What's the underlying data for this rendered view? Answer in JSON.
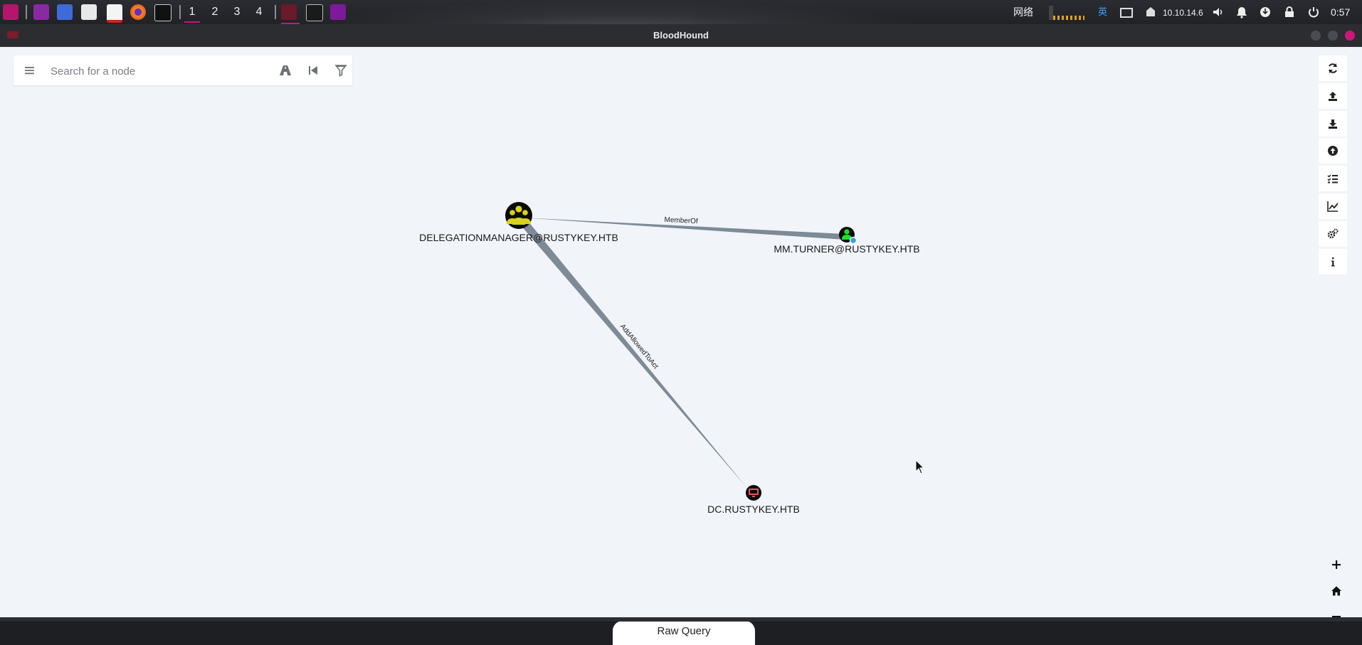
{
  "taskbar": {
    "workspaces": [
      "1",
      "2",
      "3",
      "4"
    ],
    "active_workspace": "1",
    "network_label": "网络",
    "input_method": "英",
    "ip_address": "10.10.14.6",
    "clock": "0:57"
  },
  "window": {
    "title": "BloodHound"
  },
  "search": {
    "placeholder": "Search for a node"
  },
  "graph": {
    "nodes": [
      {
        "id": "group",
        "label": "DELEGATIONMANAGER@RUSTYKEY.HTB",
        "kind": "group",
        "color": "#d9d21a"
      },
      {
        "id": "user",
        "label": "MM.TURNER@RUSTYKEY.HTB",
        "kind": "user",
        "color": "#17e625"
      },
      {
        "id": "computer",
        "label": "DC.RUSTYKEY.HTB",
        "kind": "computer",
        "color": "#e45a5a"
      }
    ],
    "edges": [
      {
        "from": "user",
        "to": "group",
        "label": "MemberOf"
      },
      {
        "from": "group",
        "to": "computer",
        "label": "AddAllowedToAct"
      }
    ]
  },
  "raw_query": {
    "label": "Raw Query"
  },
  "colors": {
    "canvas": "#f1f4f9",
    "edge": "#7d8b97",
    "accent": "#c71585"
  }
}
